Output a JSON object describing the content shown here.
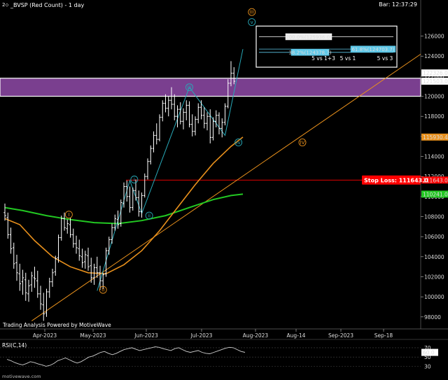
{
  "header": {
    "title": "_BVSP (Red Count) - 1 day",
    "bar_time": "Bar: 12:37:29"
  },
  "footer": {
    "powered": "Trading Analysis Powered by MotiveWave",
    "watermark": "motivewave.com"
  },
  "colors": {
    "background": "#000000",
    "purple_zone": "#7a3f8f",
    "ma_green": "#22c822",
    "ma_orange": "#e8901c",
    "trendline": "#e8901c",
    "wave_cyan": "#28a9b8",
    "stop_red": "#ff0000",
    "label_bg": "#ffffff"
  },
  "chart_data": {
    "type": "ohlc",
    "title": "_BVSP (Red Count) - 1 day",
    "x_ticks": [
      "Apr-2023",
      "May-2023",
      "Jun-2023",
      "Jul-2023",
      "Aug-2023",
      "Aug-14",
      "Sep-2023",
      "Sep-18"
    ],
    "y_ticks": [
      98000,
      100000,
      102000,
      104000,
      106000,
      108000,
      110000,
      112000,
      114000,
      116000,
      118000,
      120000,
      122000,
      124000,
      126000
    ],
    "ylim": [
      96800,
      129600
    ],
    "price_labels": [
      {
        "text": "122326.0",
        "value": 122326,
        "color": "#ffffff"
      },
      {
        "text": "121503.0",
        "value": 121503,
        "color": "#ffffff"
      },
      {
        "text": "115930.4",
        "value": 115930,
        "color": "#e8901c"
      },
      {
        "text": "111643.0",
        "value": 111643,
        "color": "#ff0000"
      },
      {
        "text": "110241.0",
        "value": 110241,
        "color": "#22c822"
      }
    ],
    "stop_loss": {
      "label": "Stop Loss: 111643.0",
      "value": 111643
    },
    "target_zone": {
      "low": 120000,
      "high": 121800
    },
    "projection_box": {
      "lines": [
        {
          "text": "200.0%(125936.0)",
          "value": 125936,
          "color": "#ffffff"
        },
        {
          "text": "38.2%(124378.7)",
          "value": 124379,
          "color": "#5ec8e8"
        },
        {
          "text": "61.8%(124703.7)",
          "value": 124704,
          "color": "#5ec8e8"
        }
      ],
      "captions": [
        "5 vs 1+3",
        "5 vs 1",
        "5 vs 3"
      ]
    },
    "wave_labels": [
      {
        "text": "I",
        "value": 108200,
        "color": "#e8901c",
        "circled": true
      },
      {
        "text": "II",
        "value": 100700,
        "color": "#e8901c",
        "circled": true
      },
      {
        "text": "III",
        "value": 128400,
        "color": "#e8901c",
        "circled": true
      },
      {
        "text": "IV",
        "value": 115400,
        "color": "#e8901c",
        "circled": true
      },
      {
        "text": "i",
        "value": 111700,
        "color": "#28a9b8",
        "circled": true
      },
      {
        "text": "ii",
        "value": 108100,
        "color": "#28a9b8",
        "circled": true
      },
      {
        "text": "iii",
        "value": 120900,
        "color": "#28a9b8",
        "circled": true
      },
      {
        "text": "iv",
        "value": 115400,
        "color": "#28a9b8",
        "circled": true
      },
      {
        "text": "v",
        "value": 127400,
        "color": "#28a9b8",
        "circled": true
      }
    ],
    "rsi": {
      "label": "RSI(C,14)",
      "ticks": [
        70,
        50,
        30
      ],
      "value_label": "60.0",
      "ylim": [
        20,
        85
      ],
      "values": [
        45,
        42,
        38,
        35,
        33,
        36,
        40,
        38,
        35,
        33,
        30,
        32,
        36,
        42,
        45,
        48,
        44,
        40,
        37,
        40,
        45,
        50,
        52,
        56,
        60,
        62,
        58,
        55,
        58,
        62,
        66,
        68,
        70,
        67,
        64,
        66,
        68,
        70,
        72,
        71,
        68,
        66,
        64,
        68,
        70,
        66,
        62,
        60,
        62,
        64,
        60,
        58,
        57,
        60,
        63,
        66,
        69,
        71,
        70,
        66,
        62,
        60
      ]
    },
    "ohlc": [
      [
        108400,
        109300,
        107600,
        108100
      ],
      [
        107900,
        108400,
        105800,
        106200
      ],
      [
        106200,
        106900,
        104300,
        104800
      ],
      [
        104900,
        105400,
        102800,
        103300
      ],
      [
        103400,
        104200,
        101600,
        102400
      ],
      [
        102300,
        103300,
        100600,
        101300
      ],
      [
        101500,
        102700,
        100200,
        101900
      ],
      [
        101700,
        102400,
        99600,
        100400
      ],
      [
        100300,
        101700,
        99500,
        101100
      ],
      [
        101200,
        102500,
        100500,
        102100
      ],
      [
        101900,
        103000,
        100900,
        101800
      ],
      [
        101600,
        102600,
        99900,
        100300
      ],
      [
        100300,
        101100,
        98700,
        99300
      ],
      [
        99200,
        100400,
        97600,
        98300
      ],
      [
        98400,
        100800,
        98000,
        100500
      ],
      [
        100500,
        101900,
        99900,
        101500
      ],
      [
        101500,
        102800,
        101000,
        102400
      ],
      [
        102500,
        104100,
        102100,
        103800
      ],
      [
        103900,
        106200,
        103400,
        105900
      ],
      [
        105900,
        108100,
        105600,
        107800
      ],
      [
        107800,
        108400,
        106600,
        106900
      ],
      [
        106800,
        107700,
        106300,
        107300
      ],
      [
        107200,
        107900,
        105900,
        106200
      ],
      [
        106200,
        106800,
        104900,
        105300
      ],
      [
        105300,
        106100,
        104300,
        104900
      ],
      [
        104800,
        105700,
        103600,
        104100
      ],
      [
        104000,
        104800,
        102900,
        103400
      ],
      [
        103500,
        104600,
        102800,
        104200
      ],
      [
        104100,
        104900,
        102600,
        103000
      ],
      [
        103100,
        103900,
        101400,
        101900
      ],
      [
        101900,
        103300,
        101200,
        102900
      ],
      [
        102900,
        104000,
        101900,
        102400
      ],
      [
        102400,
        103100,
        100700,
        101600
      ],
      [
        101600,
        102400,
        100800,
        102200
      ],
      [
        102300,
        104900,
        102000,
        104600
      ],
      [
        104600,
        106000,
        104200,
        105700
      ],
      [
        105700,
        107300,
        105300,
        106900
      ],
      [
        106900,
        108200,
        106600,
        107800
      ],
      [
        107700,
        108600,
        106800,
        107200
      ],
      [
        107300,
        109700,
        107000,
        109400
      ],
      [
        109300,
        111400,
        108900,
        111000
      ],
      [
        111000,
        111600,
        109500,
        110000
      ],
      [
        110000,
        111000,
        108400,
        108900
      ],
      [
        108900,
        110900,
        108600,
        110600
      ],
      [
        110600,
        111700,
        109600,
        109900
      ],
      [
        109900,
        110600,
        108000,
        108500
      ],
      [
        108500,
        110400,
        107900,
        110100
      ],
      [
        110100,
        112300,
        109900,
        112000
      ],
      [
        112000,
        113800,
        111700,
        113500
      ],
      [
        113500,
        115100,
        113200,
        114800
      ],
      [
        114800,
        116500,
        114400,
        116100
      ],
      [
        116100,
        117300,
        115200,
        115700
      ],
      [
        115700,
        118200,
        115500,
        117900
      ],
      [
        117900,
        119600,
        117500,
        119300
      ],
      [
        119300,
        120200,
        118400,
        118800
      ],
      [
        118800,
        120000,
        118000,
        119600
      ],
      [
        119600,
        120900,
        118700,
        119200
      ],
      [
        119200,
        120200,
        117600,
        118000
      ],
      [
        118000,
        119100,
        116900,
        118700
      ],
      [
        118700,
        119400,
        117200,
        117500
      ],
      [
        117500,
        118800,
        116700,
        118400
      ],
      [
        118400,
        119600,
        117600,
        119100
      ],
      [
        119100,
        119500,
        116900,
        117200
      ],
      [
        117200,
        118200,
        116000,
        116500
      ],
      [
        116500,
        118000,
        116100,
        117700
      ],
      [
        117700,
        119300,
        117300,
        118900
      ],
      [
        118900,
        119600,
        117700,
        118100
      ],
      [
        118100,
        118900,
        116800,
        117300
      ],
      [
        117300,
        118400,
        116600,
        118000
      ],
      [
        118000,
        118700,
        115300,
        115900
      ],
      [
        115900,
        117900,
        115600,
        117500
      ],
      [
        117500,
        118600,
        116900,
        118100
      ],
      [
        118100,
        118400,
        116200,
        116800
      ],
      [
        116800,
        117800,
        115900,
        117400
      ],
      [
        117400,
        119300,
        117100,
        119000
      ],
      [
        119000,
        121700,
        118800,
        121300
      ],
      [
        121300,
        123500,
        121000,
        122300
      ],
      [
        122300,
        122900,
        121200,
        121500
      ]
    ],
    "ma_green": [
      [
        0,
        108900
      ],
      [
        6,
        108600
      ],
      [
        14,
        108100
      ],
      [
        22,
        107700
      ],
      [
        30,
        107400
      ],
      [
        38,
        107300
      ],
      [
        46,
        107600
      ],
      [
        54,
        108100
      ],
      [
        62,
        108900
      ],
      [
        70,
        109700
      ],
      [
        76,
        110100
      ],
      [
        80,
        110241
      ]
    ],
    "ma_orange": [
      [
        0,
        107800
      ],
      [
        5,
        107200
      ],
      [
        10,
        105600
      ],
      [
        16,
        104000
      ],
      [
        22,
        103000
      ],
      [
        28,
        102400
      ],
      [
        34,
        102300
      ],
      [
        40,
        103200
      ],
      [
        46,
        104600
      ],
      [
        52,
        106600
      ],
      [
        58,
        108900
      ],
      [
        64,
        111200
      ],
      [
        70,
        113300
      ],
      [
        76,
        115000
      ],
      [
        80,
        115930
      ]
    ]
  }
}
